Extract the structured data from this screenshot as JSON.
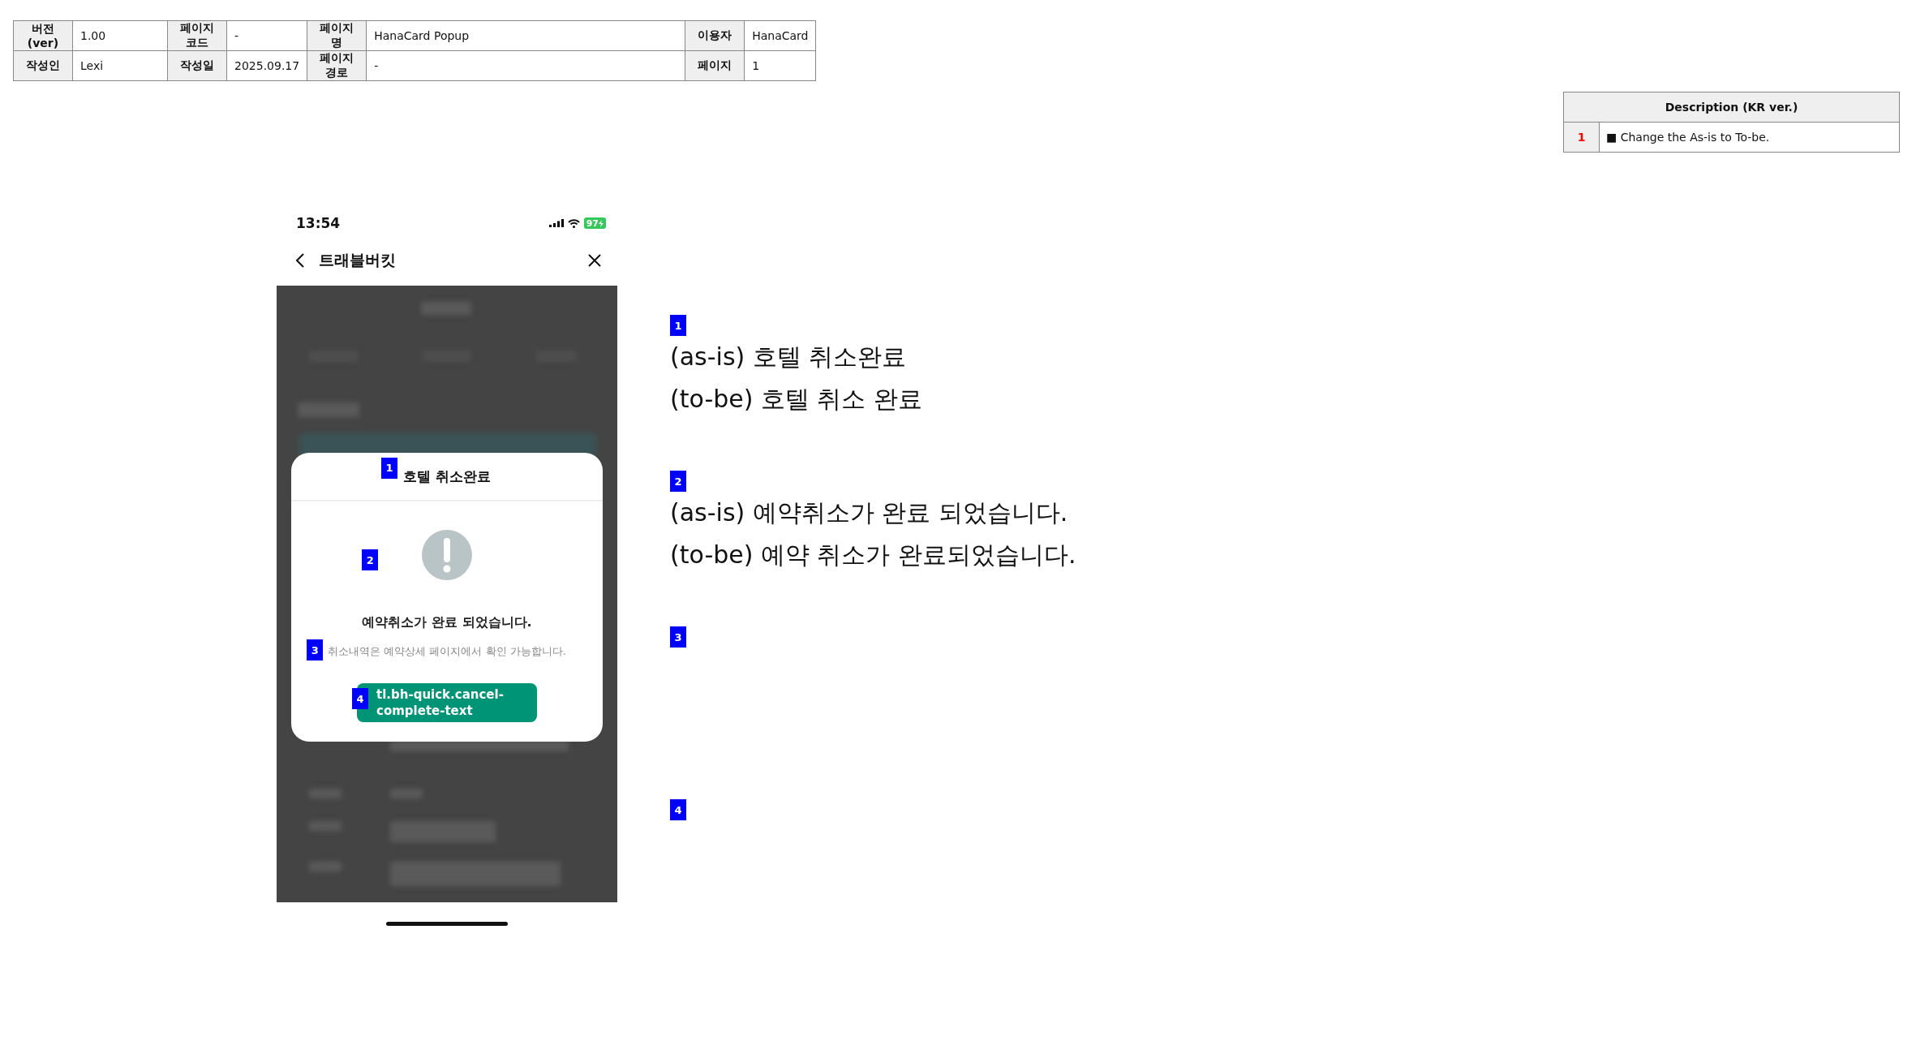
{
  "meta_table": {
    "rows": [
      {
        "cells": [
          {
            "label": "버전(ver)",
            "value": "1.00"
          },
          {
            "label": "페이지코드",
            "value": "-"
          },
          {
            "label": "페이지명",
            "value": "HanaCard Popup"
          },
          {
            "label": "이용자",
            "value": "HanaCard"
          }
        ]
      },
      {
        "cells": [
          {
            "label": "작성인",
            "value": "Lexi"
          },
          {
            "label": "작성일",
            "value": "2025.09.17"
          },
          {
            "label": "페이지 경로",
            "value": "-"
          },
          {
            "label": "페이지",
            "value": "1"
          }
        ]
      }
    ]
  },
  "description": {
    "title": "Description (KR ver.)",
    "rows": [
      {
        "number": "1",
        "bullet": "■",
        "text": "Change the As-is to To-be."
      }
    ]
  },
  "phone": {
    "status_bar": {
      "time": "13:54",
      "battery": "97"
    },
    "nav": {
      "title": "트래블버킷"
    },
    "modal": {
      "title": "호텔 취소완료",
      "title_marker": "1",
      "message": "예약취소가 완료 되었습니다.",
      "message_marker": "2",
      "note": "취소내역은 예약상세 페이지에서 확인 가능합니다.",
      "note_marker": "3",
      "button": "tl.bh-quick.cancel-complete-text",
      "button_marker": "4"
    }
  },
  "annotations": [
    {
      "marker": "1",
      "lines": [
        "(as-is) 호텔 취소완료",
        "(to-be) 호텔 취소 완료"
      ]
    },
    {
      "marker": "2",
      "lines": [
        "(as-is) 예약취소가 완료 되었습니다.",
        "(to-be) 예약 취소가 완료되었습니다."
      ]
    },
    {
      "marker": "3"
    },
    {
      "marker": "4"
    }
  ]
}
